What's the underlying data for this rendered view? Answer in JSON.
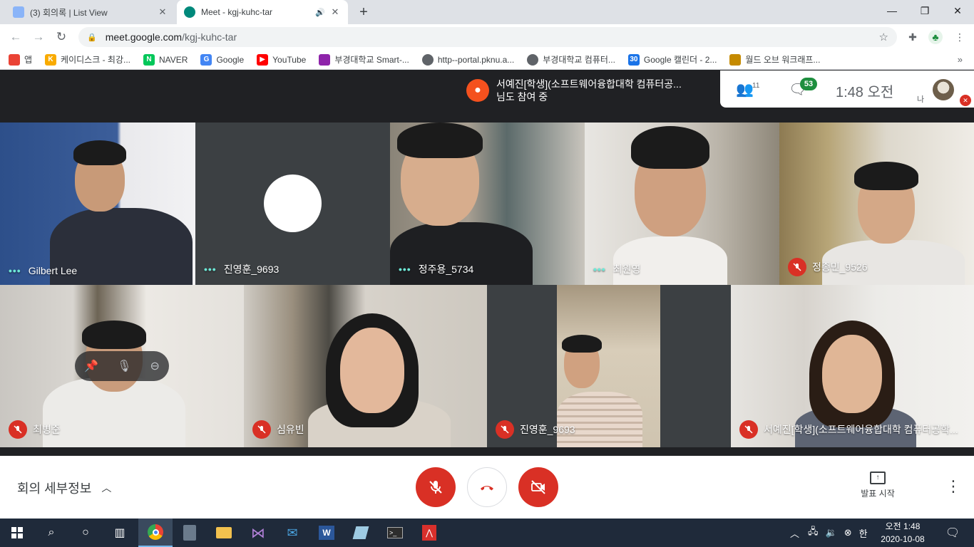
{
  "browser": {
    "tabs": [
      {
        "title": "(3) 회의록 | List View",
        "active": false
      },
      {
        "title": "Meet - kgj-kuhc-tar",
        "active": true
      }
    ],
    "url_host": "meet.google.com",
    "url_path": "/kgj-kuhc-tar",
    "bookmarks": [
      {
        "label": "앱",
        "color": "#ea4335"
      },
      {
        "label": "케이디스크 - 최강...",
        "color": "#f9ab00"
      },
      {
        "label": "NAVER",
        "color": "#03c75a"
      },
      {
        "label": "Google",
        "color": "#4285f4"
      },
      {
        "label": "YouTube",
        "color": "#ff0000"
      },
      {
        "label": "부경대학교 Smart-...",
        "color": "#8e24aa"
      },
      {
        "label": "http--portal.pknu.a...",
        "color": "#5f6368"
      },
      {
        "label": "부경대학교 컴퓨터...",
        "color": "#5f6368"
      },
      {
        "label": "Google 캘린더 - 2...",
        "color": "#1a73e8"
      },
      {
        "label": "월드 오브 워크래프...",
        "color": "#c58a00"
      }
    ]
  },
  "meet": {
    "notice_line1": "서예진[학생](소프트웨어융합대학 컴퓨터공...",
    "notice_line2": "님도 참여 중",
    "people_count": "11",
    "chat_count": "53",
    "time": "1:48 오전",
    "me_label": "나",
    "tiles": [
      {
        "name": "Gilbert Lee",
        "state": "speaking"
      },
      {
        "name": "진영훈_9693",
        "state": "speaking"
      },
      {
        "name": "정주용_5734",
        "state": "speaking"
      },
      {
        "name": "최원영",
        "state": "speaking"
      },
      {
        "name": "정종민_9526",
        "state": "muted"
      },
      {
        "name": "최병준",
        "state": "muted"
      },
      {
        "name": "심유빈",
        "state": "muted"
      },
      {
        "name": "진영훈_9693",
        "state": "muted"
      },
      {
        "name": "서예진[학생](소프트웨어융합대학 컴퓨터공학...",
        "state": "muted"
      }
    ],
    "meeting_details": "회의 세부정보",
    "present_label": "발표 시작"
  },
  "taskbar": {
    "time": "오전 1:48",
    "date": "2020-10-08",
    "ime": "한"
  }
}
